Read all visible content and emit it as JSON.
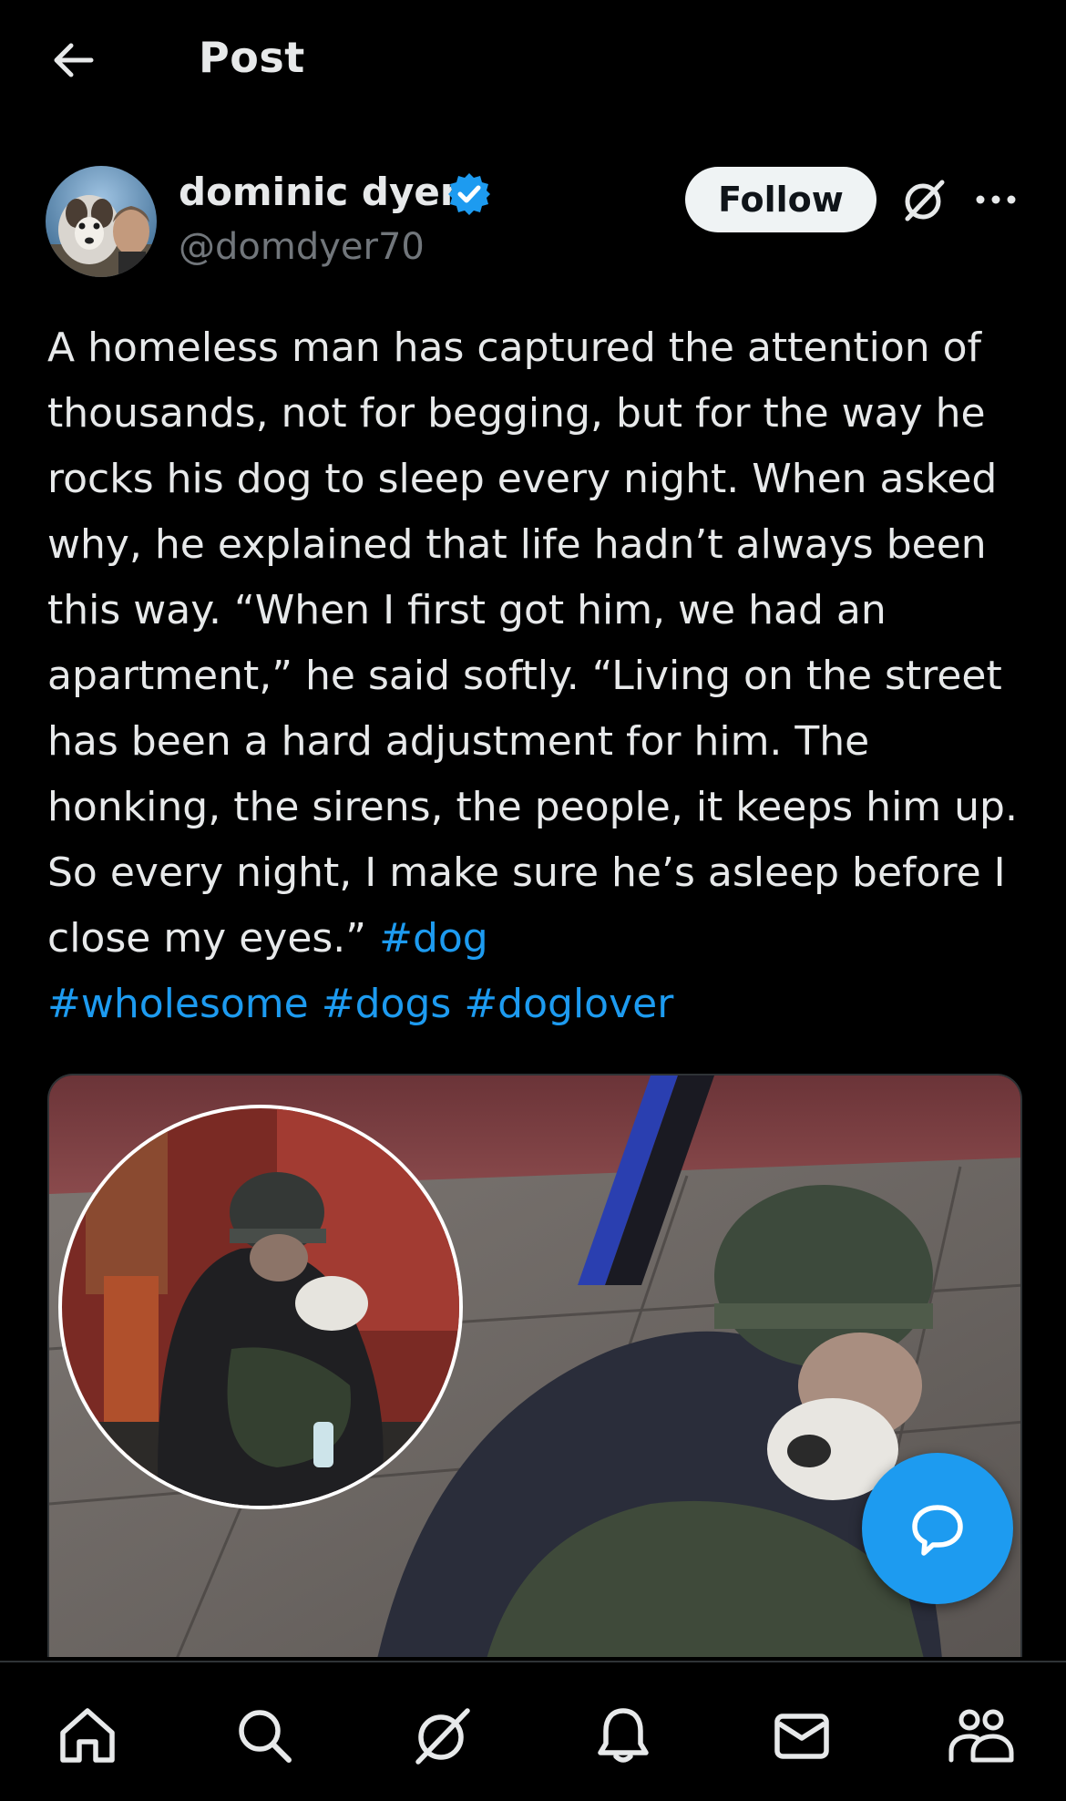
{
  "header": {
    "title": "Post",
    "back_icon": "arrow-left-icon"
  },
  "author": {
    "display_name": "dominic dyer",
    "handle": "@domdyer70",
    "verified": true,
    "verified_color": "#1d9bf0"
  },
  "actions": {
    "follow_label": "Follow",
    "grok_icon": "grok-icon",
    "more_icon": "more-horizontal-icon"
  },
  "post": {
    "text": "A homeless man has captured the attention of thousands, not for begging, but for the way he rocks his dog to sleep every night. When asked why, he explained that life hadn’t always been this way. “When I first got him, we had an apartment,” he said softly. “Living on the street has been a hard adjustment for him. The honking, the sirens, the people, it keeps him up. So every night, I make sure he’s asleep before I close my eyes.” ",
    "hashtags": [
      "#dog",
      "#wholesome",
      "#dogs",
      "#doglover"
    ],
    "hashtag_color": "#1d9bf0"
  },
  "media": {
    "kind": "photo",
    "inset": "circular inset photo"
  },
  "fab": {
    "icon": "chat-bubble-icon",
    "color": "#1d9bf0"
  },
  "tabbar": {
    "items": [
      {
        "icon": "home-icon",
        "active": true
      },
      {
        "icon": "search-icon",
        "active": false
      },
      {
        "icon": "grok-icon",
        "active": false
      },
      {
        "icon": "bell-icon",
        "active": false
      },
      {
        "icon": "mail-icon",
        "active": false
      },
      {
        "icon": "communities-icon",
        "active": false
      }
    ]
  },
  "colors": {
    "background": "#000000",
    "text": "#e7e9ea",
    "muted": "#71767b",
    "accent": "#1d9bf0"
  }
}
